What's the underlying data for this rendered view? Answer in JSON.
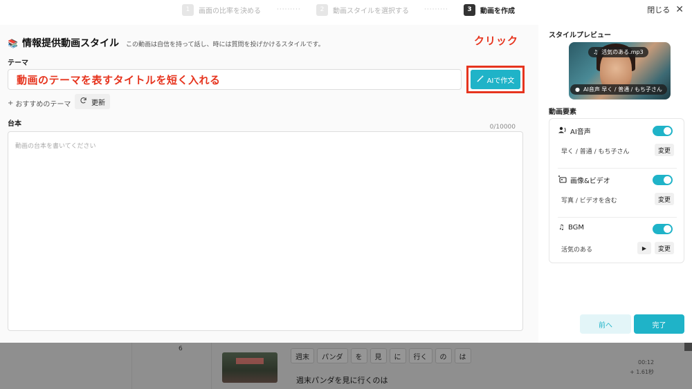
{
  "steps": [
    {
      "num": "1",
      "label": "画面の比率を決める"
    },
    {
      "num": "2",
      "label": "動画スタイルを選択する"
    },
    {
      "num": "3",
      "label": "動画を作成"
    }
  ],
  "step_separator": "·········",
  "close_label": "閉じる",
  "main": {
    "style_emoji": "📚",
    "style_title": "情報提供動画スタイル",
    "style_desc": "この動画は自信を持って話し、時には質問を投げかけるスタイルです。",
    "click_annotation": "クリック",
    "theme_label": "テーマ",
    "theme_value": "動画のテーマを表すタイトルを短く入れる",
    "ai_button_label": "AIで作文",
    "recommend_label": "おすすめのテーマ",
    "refresh_label": "更新",
    "script_label": "台本",
    "script_counter": "0/10000",
    "script_placeholder": "動画の台本を書いてください"
  },
  "side": {
    "preview_title": "スタイルプレビュー",
    "preview_music": "活気のある.mp3",
    "preview_voice": "AI音声  早く / 普通 / もち子さん",
    "elements_title": "動画要素",
    "elements": [
      {
        "name": "AI音声",
        "sub": "早く / 普通 / もち子さん",
        "change": "変更",
        "enabled": true
      },
      {
        "name": "画像&ビデオ",
        "sub": "写真 / ビデオを含む",
        "change": "変更",
        "enabled": true
      },
      {
        "name": "BGM",
        "sub": "活気のある",
        "change": "変更",
        "enabled": true
      }
    ],
    "prev_label": "前へ",
    "done_label": "完了"
  },
  "background": {
    "row_number": "6",
    "words": [
      "週末",
      "パンダ",
      "を",
      "見",
      "に",
      "行く",
      "の",
      "は"
    ],
    "sentence": "週末パンダを見に行くのは",
    "time": "00:12",
    "duration": "+ 1.61秒"
  },
  "colors": {
    "accent": "#1fb3c8",
    "annotation_red": "#e6341e"
  }
}
